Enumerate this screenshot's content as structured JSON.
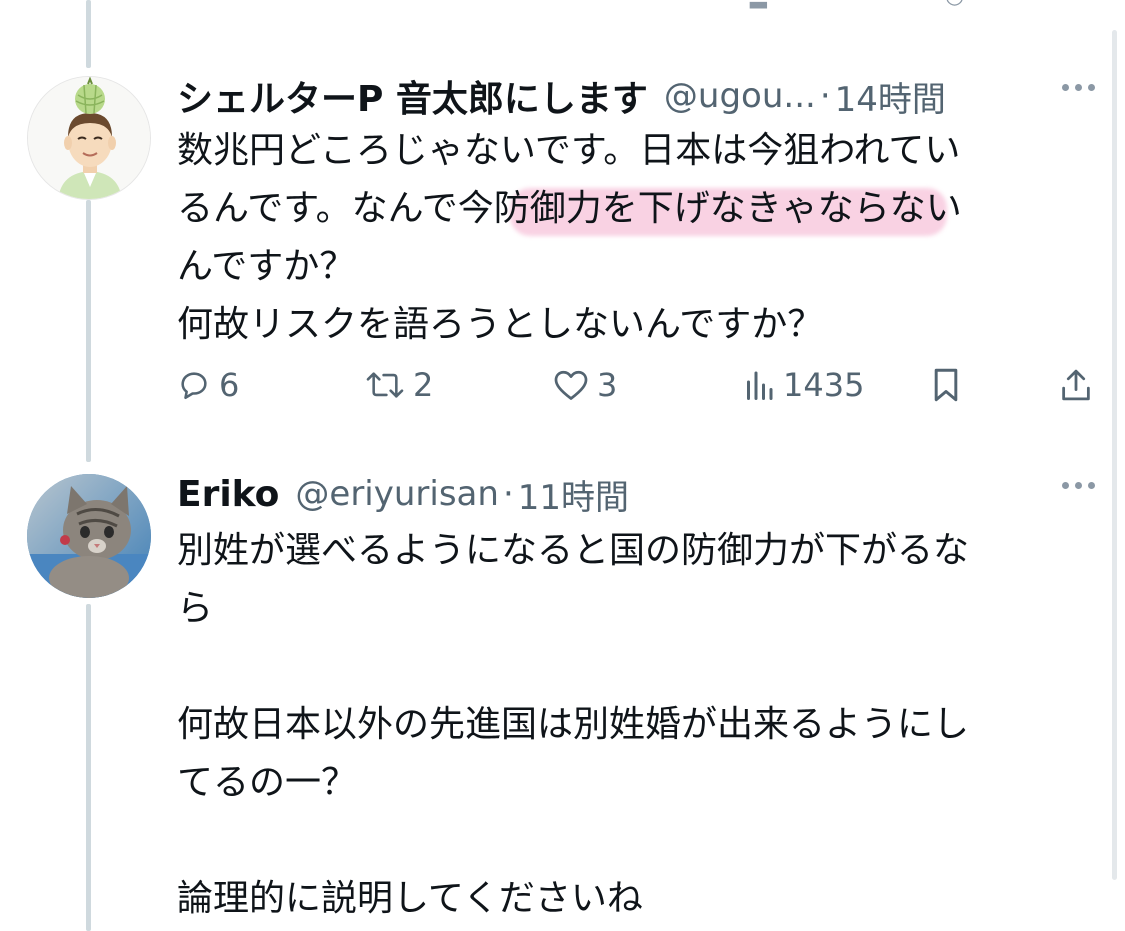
{
  "tweets": [
    {
      "name": "シェルターP 音太郎にします",
      "handle": "@ugou...",
      "separator": "·",
      "time": "14時間",
      "avatar_icon": "melon-head-person-avatar",
      "text_lines": [
        "数兆円どころじゃないです。日本は今狙われてい",
        "るんです。なんで今防御力を下げなきゃならない",
        "んですか？",
        "何故リスクを語ろうとしないんですか？"
      ],
      "highlighted_phrase": "今防御力を下げなきゃなら",
      "highlight_color": "#f7c3da",
      "actions": {
        "replies": "6",
        "retweets": "2",
        "likes": "3",
        "views": "1435"
      }
    },
    {
      "name": "Eriko",
      "handle": "@eriyurisan",
      "separator": "·",
      "time": "11時間",
      "avatar_icon": "cat-photo-avatar",
      "text_lines": [
        "別姓が選べるようになると国の防御力が下がるな",
        "ら",
        "",
        "何故日本以外の先進国は別姓婚が出来るようにし",
        "てるの一？",
        "",
        "論理的に説明してくださいね"
      ]
    }
  ],
  "colors": {
    "text": "#0f1419",
    "secondary": "#536471",
    "thread_line": "#cfd9de"
  }
}
